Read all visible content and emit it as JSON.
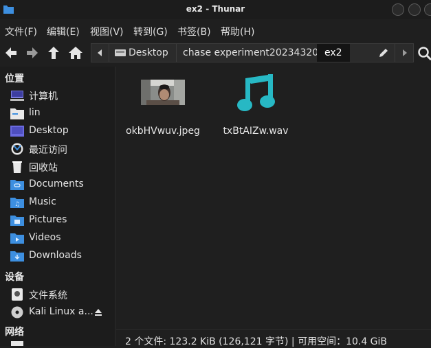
{
  "window": {
    "title": "ex2 - Thunar"
  },
  "menu": [
    "文件(F)",
    "编辑(E)",
    "视图(V)",
    "转到(G)",
    "书签(B)",
    "帮助(H)"
  ],
  "path": [
    "Desktop",
    "chase experiment20234320",
    "ex2"
  ],
  "sidebar": {
    "places_header": "位置",
    "places": [
      {
        "label": "计算机",
        "icon": "computer-icon"
      },
      {
        "label": "lin",
        "icon": "home-folder-icon"
      },
      {
        "label": "Desktop",
        "icon": "desktop-folder-icon"
      },
      {
        "label": "最近访问",
        "icon": "recent-icon"
      },
      {
        "label": "回收站",
        "icon": "trash-icon"
      },
      {
        "label": "Documents",
        "icon": "documents-folder-icon"
      },
      {
        "label": "Music",
        "icon": "music-folder-icon"
      },
      {
        "label": "Pictures",
        "icon": "pictures-folder-icon"
      },
      {
        "label": "Videos",
        "icon": "videos-folder-icon"
      },
      {
        "label": "Downloads",
        "icon": "downloads-folder-icon"
      }
    ],
    "devices_header": "设备",
    "devices": [
      {
        "label": "文件系统",
        "icon": "filesystem-icon"
      },
      {
        "label": "Kali Linux a...",
        "icon": "optical-disc-icon"
      }
    ],
    "network_header": "网络"
  },
  "files": [
    {
      "name": "okbHVwuv.jpeg",
      "icon": "image-thumbnail"
    },
    {
      "name": "txBtAIZw.wav",
      "icon": "music-note-icon"
    }
  ],
  "status": "2 个文件: 123.2 KiB (126,121 字节) | 可用空间：10.4 GiB",
  "colors": {
    "accent": "#3d8fe0",
    "teal": "#27b8c4",
    "background": "#1f1f1f"
  }
}
